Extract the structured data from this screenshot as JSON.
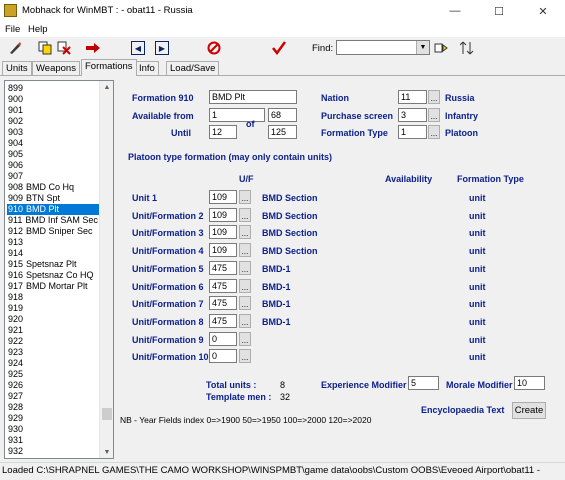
{
  "window": {
    "title": "Mobhack for WinMBT : - obat11 - Russia",
    "minimize_icon": "—",
    "maximize_icon": "☐",
    "close_icon": "✕"
  },
  "menu": {
    "file": "File",
    "help": "Help"
  },
  "toolbar": {
    "find_label": "Find:",
    "find_value": ""
  },
  "tabs": [
    "Units",
    "Weapons",
    "Formations",
    "Info",
    "Load/Save"
  ],
  "list": {
    "selected": "910",
    "items": [
      {
        "num": "899",
        "name": ""
      },
      {
        "num": "900",
        "name": ""
      },
      {
        "num": "901",
        "name": ""
      },
      {
        "num": "902",
        "name": ""
      },
      {
        "num": "903",
        "name": ""
      },
      {
        "num": "904",
        "name": ""
      },
      {
        "num": "905",
        "name": ""
      },
      {
        "num": "906",
        "name": ""
      },
      {
        "num": "907",
        "name": ""
      },
      {
        "num": "908",
        "name": "BMD Co Hq"
      },
      {
        "num": "909",
        "name": "BTN Spt"
      },
      {
        "num": "910",
        "name": "BMD Plt"
      },
      {
        "num": "911",
        "name": "BMD Inf SAM Sec"
      },
      {
        "num": "912",
        "name": "BMD Sniper Sec"
      },
      {
        "num": "913",
        "name": ""
      },
      {
        "num": "914",
        "name": ""
      },
      {
        "num": "915",
        "name": "Spetsnaz Plt"
      },
      {
        "num": "916",
        "name": "Spetsnaz Co HQ"
      },
      {
        "num": "917",
        "name": "BMD Mortar Plt"
      },
      {
        "num": "918",
        "name": ""
      },
      {
        "num": "919",
        "name": ""
      },
      {
        "num": "920",
        "name": ""
      },
      {
        "num": "921",
        "name": ""
      },
      {
        "num": "922",
        "name": ""
      },
      {
        "num": "923",
        "name": ""
      },
      {
        "num": "924",
        "name": ""
      },
      {
        "num": "925",
        "name": ""
      },
      {
        "num": "926",
        "name": ""
      },
      {
        "num": "927",
        "name": ""
      },
      {
        "num": "928",
        "name": ""
      },
      {
        "num": "929",
        "name": ""
      },
      {
        "num": "930",
        "name": ""
      },
      {
        "num": "931",
        "name": ""
      },
      {
        "num": "932",
        "name": ""
      }
    ]
  },
  "formation": {
    "header_label": "Formation 910",
    "name": "BMD Plt",
    "available_label": "Available from",
    "avail_from_month": "1",
    "avail_from_year": "68",
    "of_label": "of",
    "until_label": "Until",
    "until_month": "12",
    "until_year": "125",
    "nation_label": "Nation",
    "nation_value": "11",
    "nation_name": "Russia",
    "purchase_label": "Purchase screen",
    "purchase_value": "3",
    "purchase_name": "Infantry",
    "type_label": "Formation Type",
    "type_value": "1",
    "type_name": "Platoon",
    "note": "Platoon type formation (may only contain units)",
    "col_uf": "U/F",
    "col_availability": "Availability",
    "col_formation_type": "Formation Type",
    "rows": [
      {
        "label": "Unit 1",
        "value": "109",
        "name": "BMD Section",
        "ftype": "unit"
      },
      {
        "label": "Unit/Formation 2",
        "value": "109",
        "name": "BMD Section",
        "ftype": "unit"
      },
      {
        "label": "Unit/Formation 3",
        "value": "109",
        "name": "BMD Section",
        "ftype": "unit"
      },
      {
        "label": "Unit/Formation 4",
        "value": "109",
        "name": "BMD Section",
        "ftype": "unit"
      },
      {
        "label": "Unit/Formation 5",
        "value": "475",
        "name": "BMD-1",
        "ftype": "unit"
      },
      {
        "label": "Unit/Formation 6",
        "value": "475",
        "name": "BMD-1",
        "ftype": "unit"
      },
      {
        "label": "Unit/Formation 7",
        "value": "475",
        "name": "BMD-1",
        "ftype": "unit"
      },
      {
        "label": "Unit/Formation 8",
        "value": "475",
        "name": "BMD-1",
        "ftype": "unit"
      },
      {
        "label": "Unit/Formation 9",
        "value": "0",
        "name": "",
        "ftype": "unit"
      },
      {
        "label": "Unit/Formation 10",
        "value": "0",
        "name": "",
        "ftype": "unit"
      }
    ],
    "total_units_label": "Total units :",
    "total_units": "8",
    "template_men_label": "Template men :",
    "template_men": "32",
    "experience_label": "Experience Modifier",
    "experience_value": "5",
    "morale_label": "Morale Modifier",
    "morale_value": "10",
    "encyclopaedia_label": "Encyclopaedia Text",
    "create_label": "Create",
    "footnote": "NB - Year Fields index 0=>1900 50=>1950 100=>2000 120=>2020",
    "dots": "..."
  },
  "status": "Loaded C:\\SHRAPNEL GAMES\\THE CAMO WORKSHOP\\WINSPMBT\\game data\\oobs\\Custom OOBS\\Eveoed Airport\\obat11 -"
}
